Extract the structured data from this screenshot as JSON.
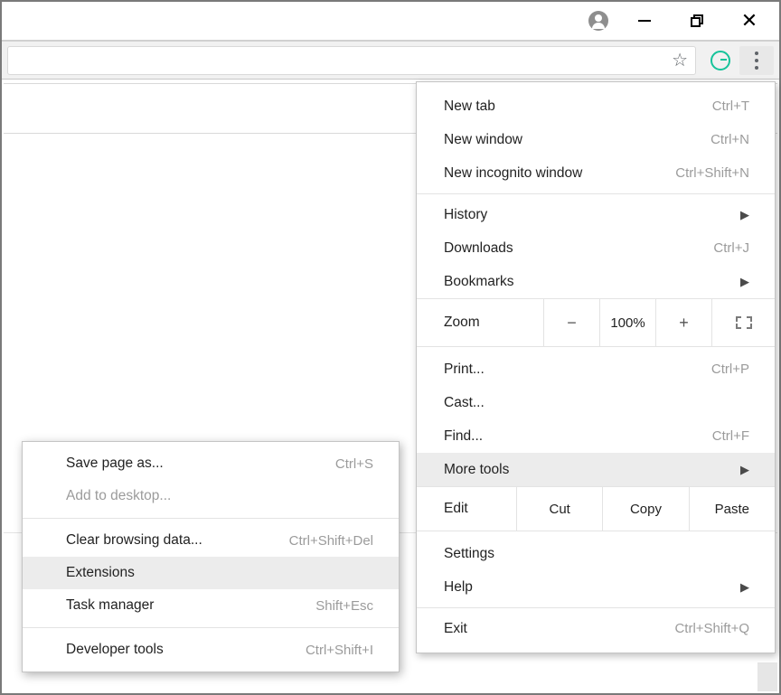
{
  "menu": {
    "new_tab": {
      "label": "New tab",
      "shortcut": "Ctrl+T"
    },
    "new_window": {
      "label": "New window",
      "shortcut": "Ctrl+N"
    },
    "new_incognito": {
      "label": "New incognito window",
      "shortcut": "Ctrl+Shift+N"
    },
    "history": {
      "label": "History"
    },
    "downloads": {
      "label": "Downloads",
      "shortcut": "Ctrl+J"
    },
    "bookmarks": {
      "label": "Bookmarks"
    },
    "zoom": {
      "label": "Zoom",
      "minus": "−",
      "value": "100%",
      "plus": "+"
    },
    "print": {
      "label": "Print...",
      "shortcut": "Ctrl+P"
    },
    "cast": {
      "label": "Cast..."
    },
    "find": {
      "label": "Find...",
      "shortcut": "Ctrl+F"
    },
    "more_tools": {
      "label": "More tools"
    },
    "edit": {
      "label": "Edit",
      "cut": "Cut",
      "copy": "Copy",
      "paste": "Paste"
    },
    "settings": {
      "label": "Settings"
    },
    "help": {
      "label": "Help"
    },
    "exit": {
      "label": "Exit",
      "shortcut": "Ctrl+Shift+Q"
    }
  },
  "submenu": {
    "save_page": {
      "label": "Save page as...",
      "shortcut": "Ctrl+S"
    },
    "add_desktop": {
      "label": "Add to desktop..."
    },
    "clear_data": {
      "label": "Clear browsing data...",
      "shortcut": "Ctrl+Shift+Del"
    },
    "extensions": {
      "label": "Extensions"
    },
    "task_manager": {
      "label": "Task manager",
      "shortcut": "Shift+Esc"
    },
    "dev_tools": {
      "label": "Developer tools",
      "shortcut": "Ctrl+Shift+I"
    }
  }
}
